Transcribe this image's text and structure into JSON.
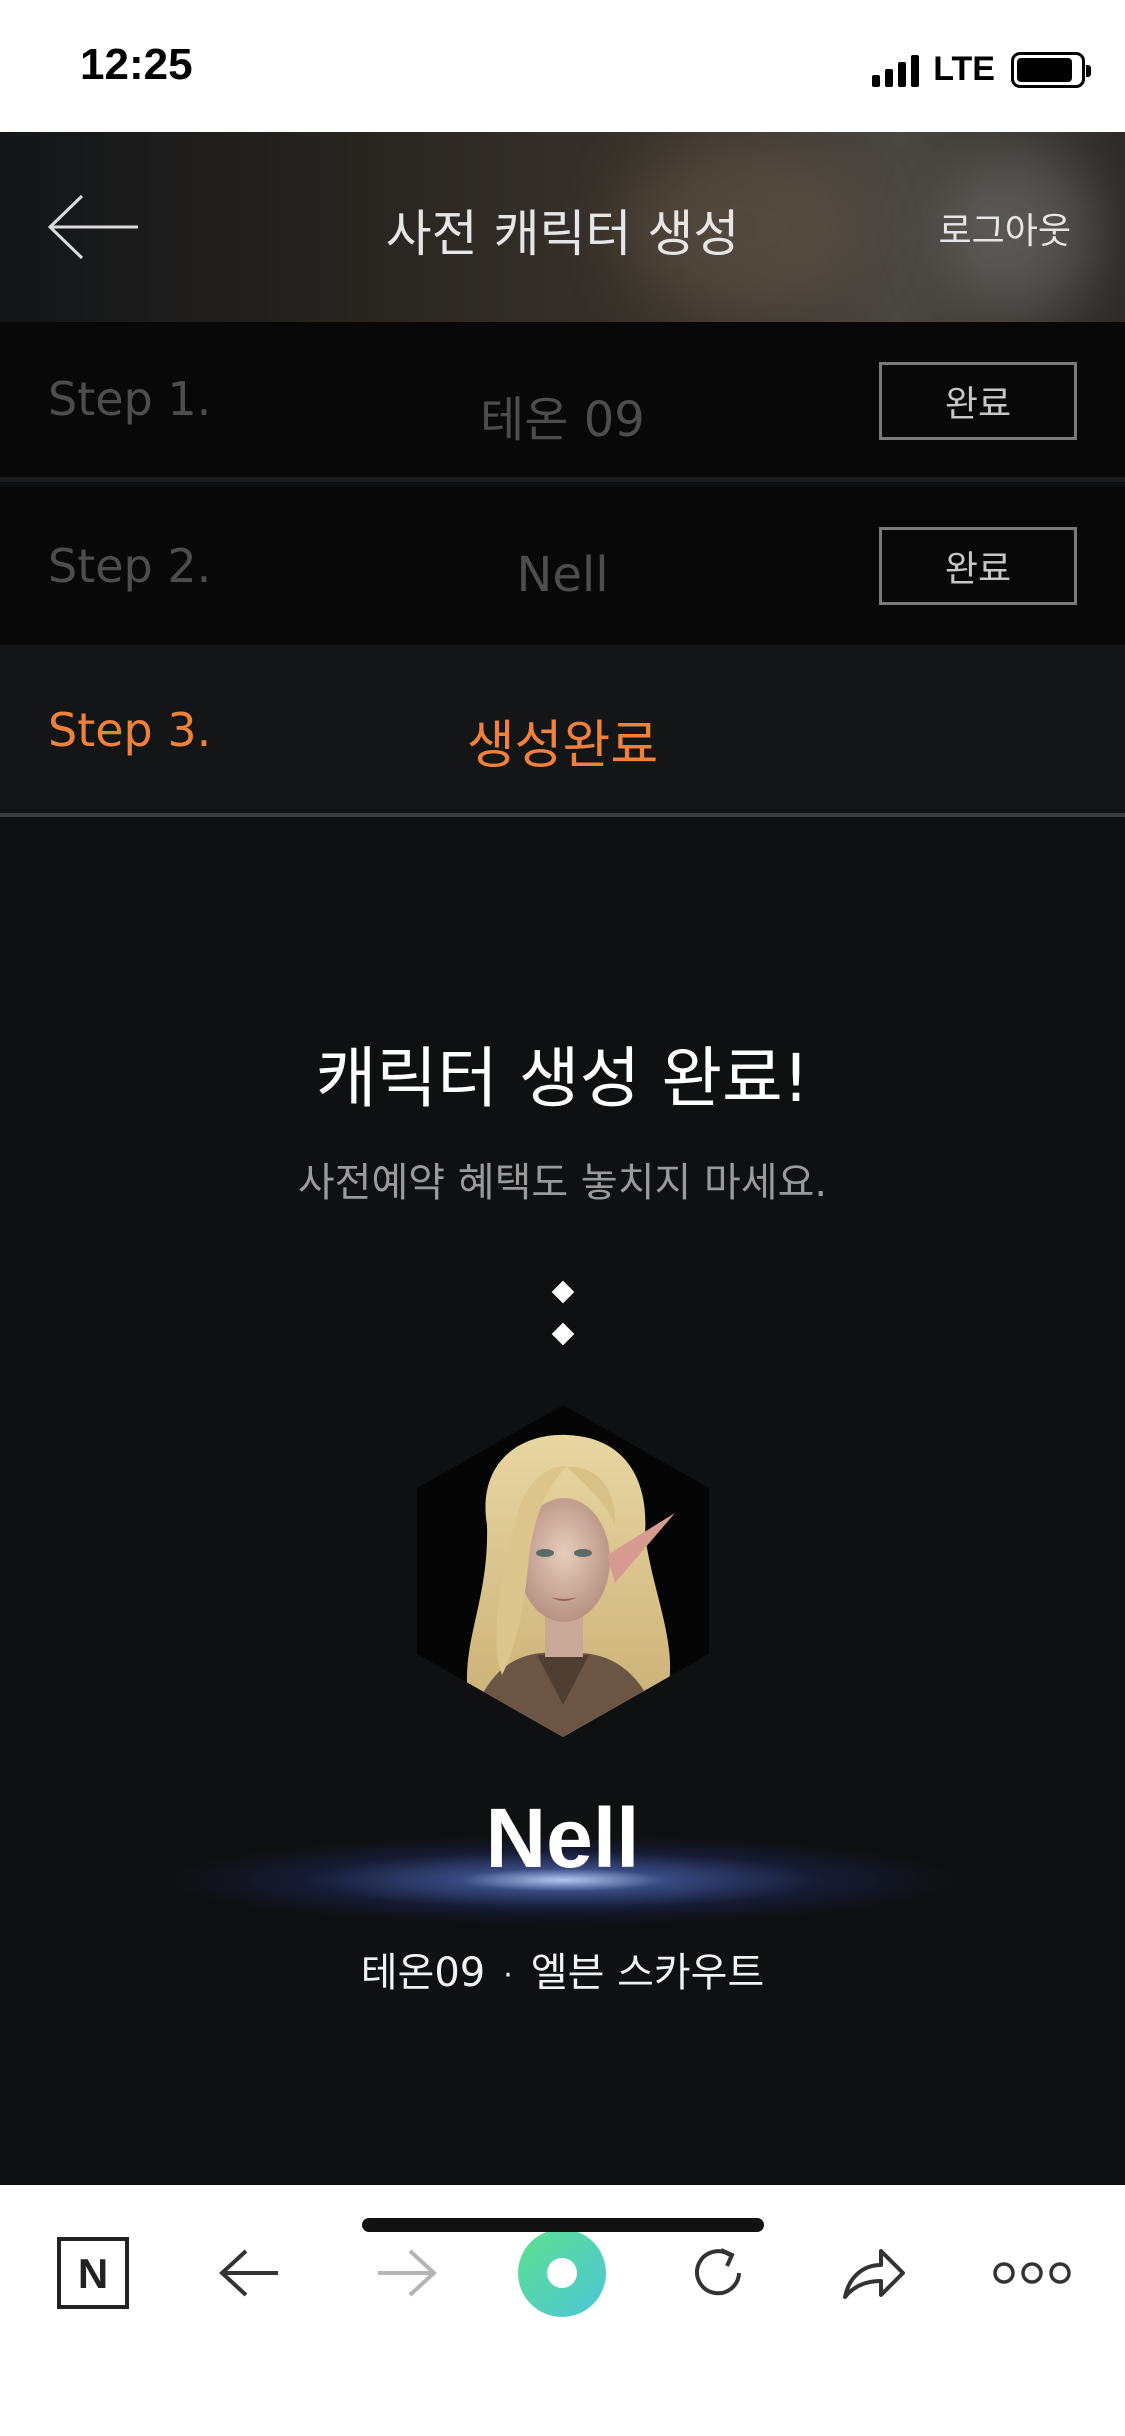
{
  "status_bar": {
    "time": "12:25",
    "network": "LTE"
  },
  "header": {
    "title": "사전 캐릭터 생성",
    "logout_label": "로그아웃",
    "back_icon": "arrow-left-icon"
  },
  "steps": [
    {
      "label": "Step 1.",
      "value": "테온 09",
      "button": "완료"
    },
    {
      "label": "Step 2.",
      "value": "Nell",
      "button": "완료"
    },
    {
      "label": "Step 3.",
      "value": "생성완료"
    }
  ],
  "result": {
    "title": "캐릭터 생성 완료!",
    "subtitle": "사전예약 혜택도 놓치지 마세요.",
    "character_name": "Nell",
    "server": "테온09",
    "separator": "·",
    "class": "엘븐 스카우트"
  },
  "colors": {
    "accent": "#f0813a",
    "background": "#0f1011",
    "toolbar_center": "#5fd8a8"
  },
  "toolbar": {
    "icons": [
      "naver-n-icon",
      "back-arrow-icon",
      "forward-arrow-icon",
      "green-dot-icon",
      "refresh-icon",
      "share-icon",
      "more-icon"
    ],
    "n_label": "N"
  }
}
